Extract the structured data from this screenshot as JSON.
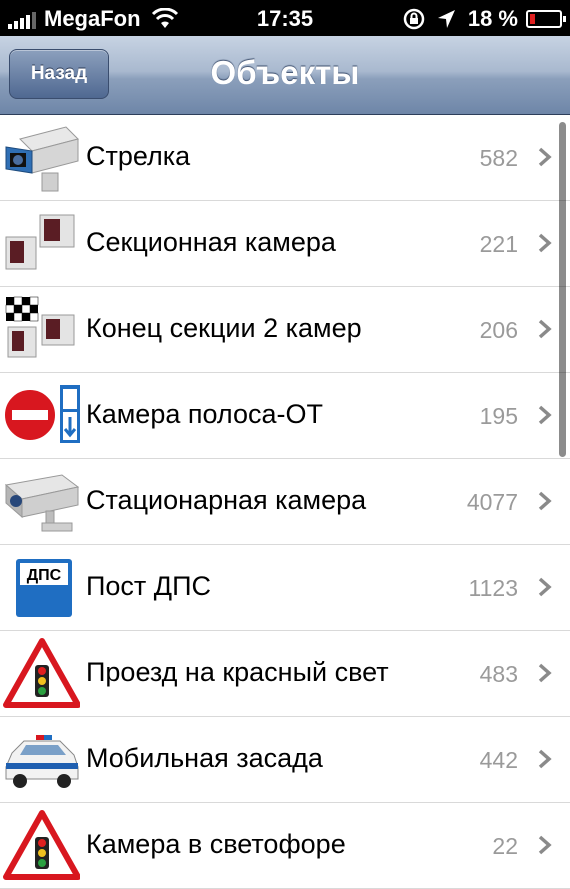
{
  "status_bar": {
    "carrier": "MegaFon",
    "time": "17:35",
    "battery_percent": "18 %",
    "battery_level": 0.18,
    "battery_color": "#e02020"
  },
  "nav": {
    "back_label": "Назад",
    "title": "Объекты"
  },
  "items": [
    {
      "label": "Стрелка",
      "count": "582",
      "icon": "strelka-camera-icon"
    },
    {
      "label": "Секционная камера",
      "count": "221",
      "icon": "section-camera-icon"
    },
    {
      "label": "Конец секции 2 камер",
      "count": "206",
      "icon": "section-end-icon"
    },
    {
      "label": "Камера полоса-ОТ",
      "count": "195",
      "icon": "lane-camera-icon"
    },
    {
      "label": "Стационарная камера",
      "count": "4077",
      "icon": "stationary-camera-icon"
    },
    {
      "label": "Пост ДПС",
      "count": "1123",
      "icon": "dps-post-icon"
    },
    {
      "label": "Проезд на красный свет",
      "count": "483",
      "icon": "red-light-icon"
    },
    {
      "label": "Мобильная засада",
      "count": "442",
      "icon": "police-car-icon"
    },
    {
      "label": "Камера в светофоре",
      "count": "22",
      "icon": "traffic-light-camera-icon"
    }
  ]
}
